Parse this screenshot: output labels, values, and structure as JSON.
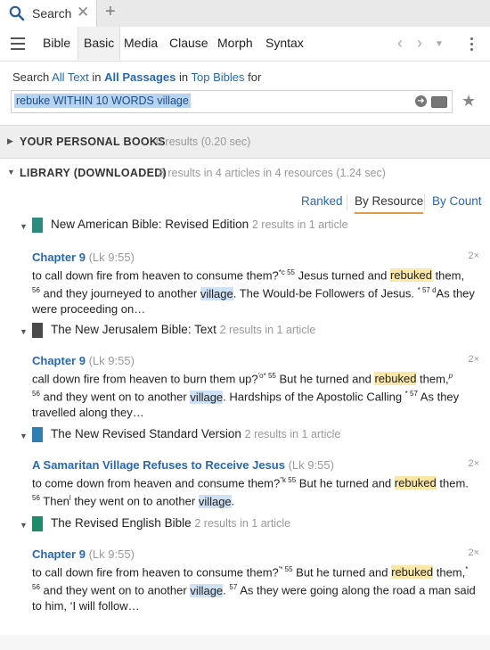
{
  "tab": {
    "label": "Search",
    "close": "✕",
    "new": "+"
  },
  "nav": {
    "tabs": [
      "Bible",
      "Basic",
      "Media",
      "Clause",
      "Morph",
      "Syntax"
    ],
    "active": "Basic"
  },
  "query": {
    "prefix": "Search",
    "scope1": "All Text",
    "in1": "in",
    "scope2": "All Passages",
    "in2": "in",
    "scope3": "Top Bibles",
    "suffix": "for",
    "value": "rebuke WITHIN 10 WORDS village"
  },
  "sections": {
    "personal": {
      "title": "YOUR PERSONAL BOOKS",
      "summary": "0 results (0.20 sec)"
    },
    "library": {
      "title": "LIBRARY (DOWNLOADED)",
      "summary": "8 results in 4 articles in 4 resources (1.24 sec)"
    }
  },
  "views": {
    "ranked": "Ranked",
    "by_resource": "By Resource",
    "by_count": "By Count"
  },
  "results": [
    {
      "title": "New American Bible: Revised Edition",
      "count": "2 results in 1 article",
      "book_color": "#2d8a7e",
      "ref": "Chapter 9",
      "loc": "(Lk 9:55)",
      "hits": "2×",
      "l1a": "to call down fire from heaven to consume them?",
      "l1b": "*c 55",
      "l1c": " Jesus turned and ",
      "l1k": "rebuked",
      "l1d": " them,",
      "l2a": "56",
      "l2b": " and they journeyed to another ",
      "l2k": "village",
      "l2c": ". The Would-be Followers of Jesus.",
      "l2d": "* 57 d",
      "l2e": "As they",
      "l3": "were proceeding on…"
    },
    {
      "title": "The New Jerusalem Bible: Text",
      "count": "2 results in 1 article",
      "book_color": "#4a4a4a",
      "ref": "Chapter 9",
      "loc": "(Lk 9:55)",
      "hits": "2×",
      "l1a": "call down fire from heaven to burn them up?",
      "l1b": "'o* 55",
      "l1c": " But he turned and ",
      "l1k": "rebuked",
      "l1d": " them,",
      "l1e": "p",
      "l2a": "56",
      "l2b": " and they went on to another ",
      "l2k": "village",
      "l2c": ". Hardships of the Apostolic Calling ",
      "l2d": "* 57",
      "l2e": " As they",
      "l3": "travelled along they…"
    },
    {
      "title": "The New Revised Standard Version",
      "count": "2 results in 1 article",
      "book_color": "#2f7fb5",
      "ref": "A Samaritan Village Refuses to Receive Jesus",
      "loc": "(Lk 9:55)",
      "hits": "2×",
      "l1a": "to come down from heaven and consume them?",
      "l1b": "\"k 55",
      "l1c": " But he turned and ",
      "l1k": "rebuked",
      "l1d": " them.",
      "l2a": "56",
      "l2b": " Then",
      "l2k0": "l",
      "l2c0": " they went on to another ",
      "l2k": "village",
      "l2c": "."
    },
    {
      "title": "The Revised English Bible",
      "count": "2 results in 1 article",
      "book_color": "#1f8a6a",
      "ref": "Chapter 9",
      "loc": "(Lk 9:55)",
      "hits": "2×",
      "l1a": "to call down fire from heaven to consume them?",
      "l1b": "'* 55",
      "l1c": " But he turned and ",
      "l1k": "rebuked",
      "l1d": " them,",
      "l1e": "*",
      "l2a": "56",
      "l2b": " and they went on to another ",
      "l2k": "village",
      "l2c": ". ",
      "l2d": "57",
      "l2e": " As they were going along the road a man said",
      "l3": "to him, ‘I will follow…"
    }
  ]
}
